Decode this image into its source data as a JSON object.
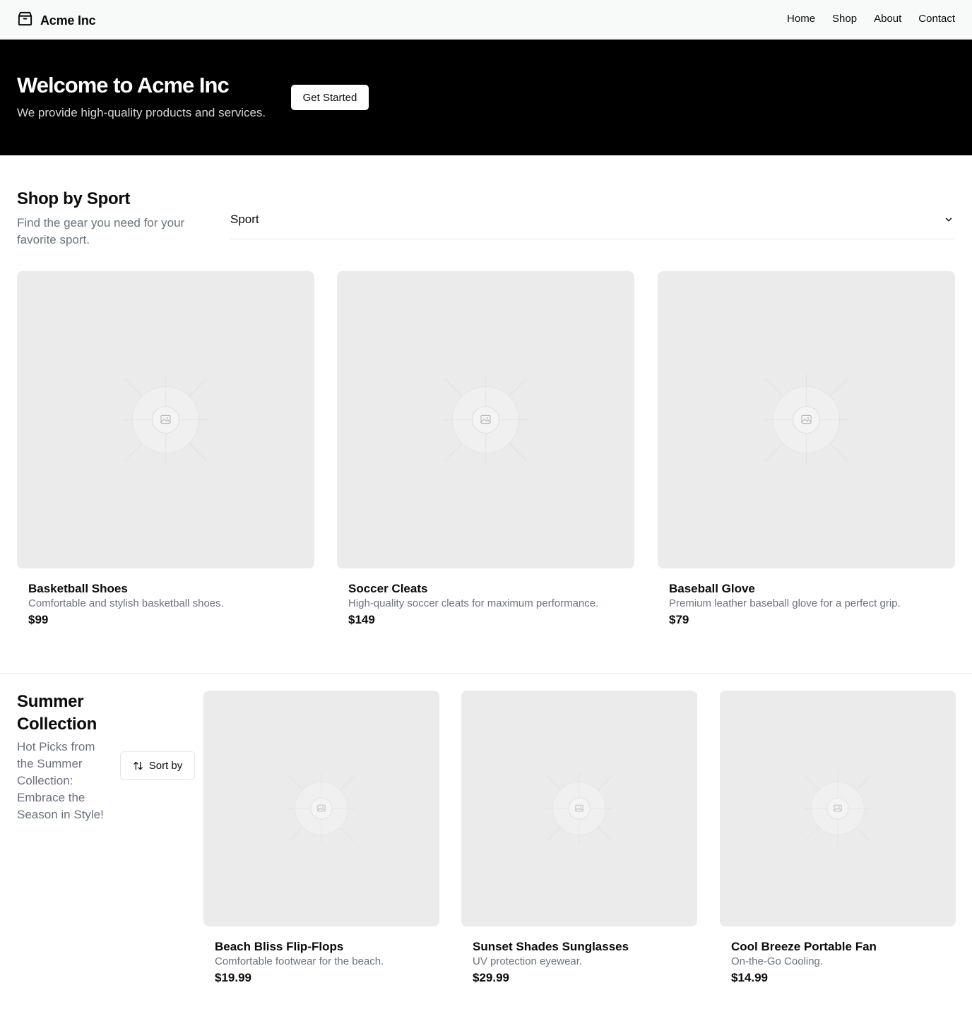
{
  "header": {
    "brand_name": "Acme Inc",
    "brand_icon": "package-icon",
    "nav": [
      {
        "label": "Home"
      },
      {
        "label": "Shop"
      },
      {
        "label": "About"
      },
      {
        "label": "Contact"
      }
    ]
  },
  "hero": {
    "title": "Welcome to Acme Inc",
    "subtitle": "We provide high-quality products and services.",
    "cta_label": "Get Started"
  },
  "sport_section": {
    "title": "Shop by Sport",
    "subtitle": "Find the gear you need for your favorite sport.",
    "select_value": "Sport",
    "select_icon": "chevron-down-icon",
    "products": [
      {
        "name": "Basketball Shoes",
        "description": "Comfortable and stylish basketball shoes.",
        "price": "$99"
      },
      {
        "name": "Soccer Cleats",
        "description": "High-quality soccer cleats for maximum performance.",
        "price": "$149"
      },
      {
        "name": "Baseball Glove",
        "description": "Premium leather baseball glove for a perfect grip.",
        "price": "$79"
      }
    ]
  },
  "summer_section": {
    "title": "Summer Collection",
    "subtitle": "Hot Picks from the Summer Collection: Embrace the Season in Style!",
    "sort_label": "Sort by",
    "sort_icon": "sort-arrows-icon",
    "products": [
      {
        "name": "Beach Bliss Flip-Flops",
        "description": "Comfortable footwear for the beach.",
        "price": "$19.99"
      },
      {
        "name": "Sunset Shades Sunglasses",
        "description": "UV protection eyewear.",
        "price": "$29.99"
      },
      {
        "name": "Cool Breeze Portable Fan",
        "description": "On-the-Go Cooling.",
        "price": "$14.99"
      }
    ]
  },
  "colors": {
    "hero_bg": "#000000",
    "header_bg": "#f8f9f9",
    "placeholder_bg": "#ebebeb",
    "muted_text": "#6b7280"
  }
}
